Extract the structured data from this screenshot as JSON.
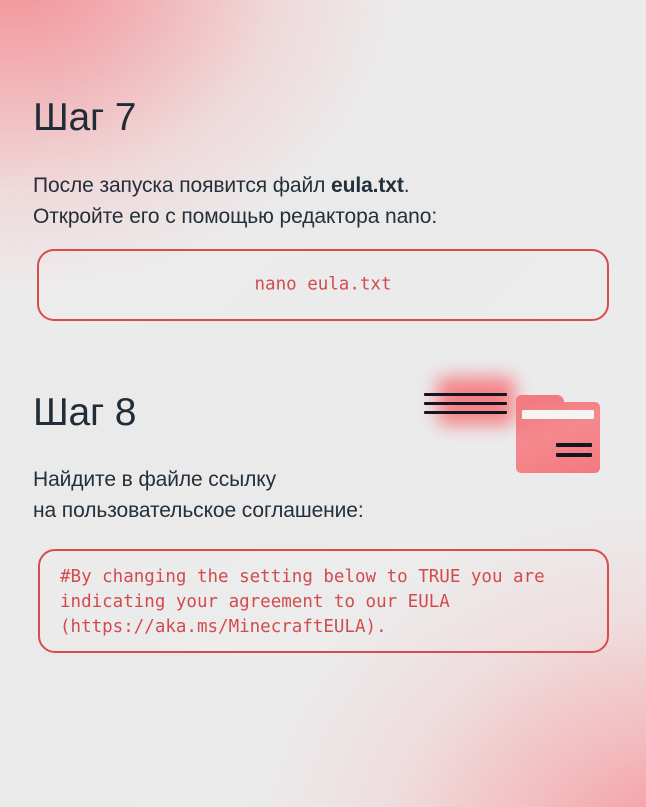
{
  "theme": {
    "accent_red": "#d2494b",
    "border_red": "#d84a4c",
    "heading_navy": "#1f2b36",
    "body_navy": "#222e38",
    "folder_pink": "#f4777c",
    "background_gray": "#ececed"
  },
  "steps": [
    {
      "heading": "Шаг 7",
      "paragraph_line_1_prefix": "После запуска появится файл ",
      "paragraph_line_1_bold": "eula.txt",
      "paragraph_line_1_suffix": ".",
      "paragraph_line_2": "Откройте его с помощью редактора nano:",
      "code": "nano eula.txt"
    },
    {
      "heading": "Шаг 8",
      "paragraph_line_1": "Найдите в файле ссылку",
      "paragraph_line_2": "на пользовательское соглашение:",
      "code": "#By changing the setting below to TRUE you are\nindicating your agreement to our EULA\n(https://aka.ms/MinecraftEULA)."
    }
  ],
  "illustration": {
    "name": "folder-with-document-lines",
    "folder_icon": "folder-icon",
    "document_icon": "document-lines-icon"
  }
}
